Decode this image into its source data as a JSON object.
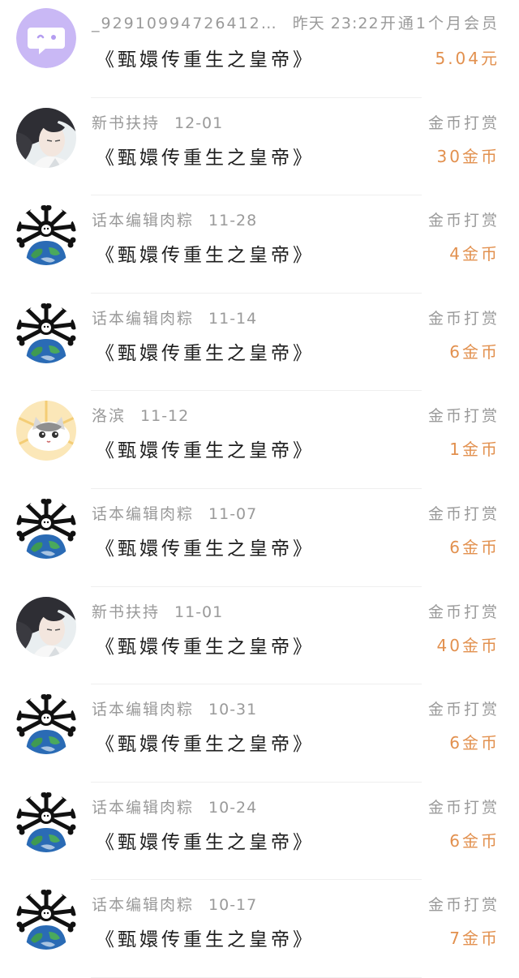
{
  "colors": {
    "amount": "#e2904e",
    "meta": "#9a9a9a",
    "title": "#1d1d1d",
    "divider": "#efefef",
    "default_avatar": "#c9b8f5"
  },
  "records": [
    {
      "user": "_92910994726412…",
      "date": "昨天 23:22",
      "title": "《甄嬛传重生之皇帝》",
      "type": "开通1个月会员",
      "amount": "5.04元",
      "avatar": "chat-bubble-avatar"
    },
    {
      "user": "新书扶持",
      "date": "12-01",
      "title": "《甄嬛传重生之皇帝》",
      "type": "金币打赏",
      "amount": "30金币",
      "avatar": "anime-portrait-avatar"
    },
    {
      "user": "话本编辑肉粽",
      "date": "11-28",
      "title": "《甄嬛传重生之皇帝》",
      "type": "金币打赏",
      "amount": "4金币",
      "avatar": "bone-globe-avatar"
    },
    {
      "user": "话本编辑肉粽",
      "date": "11-14",
      "title": "《甄嬛传重生之皇帝》",
      "type": "金币打赏",
      "amount": "6金币",
      "avatar": "bone-globe-avatar"
    },
    {
      "user": "洛滨",
      "date": "11-12",
      "title": "《甄嬛传重生之皇帝》",
      "type": "金币打赏",
      "amount": "1金币",
      "avatar": "cat-avatar"
    },
    {
      "user": "话本编辑肉粽",
      "date": "11-07",
      "title": "《甄嬛传重生之皇帝》",
      "type": "金币打赏",
      "amount": "6金币",
      "avatar": "bone-globe-avatar"
    },
    {
      "user": "新书扶持",
      "date": "11-01",
      "title": "《甄嬛传重生之皇帝》",
      "type": "金币打赏",
      "amount": "40金币",
      "avatar": "anime-portrait-avatar"
    },
    {
      "user": "话本编辑肉粽",
      "date": "10-31",
      "title": "《甄嬛传重生之皇帝》",
      "type": "金币打赏",
      "amount": "6金币",
      "avatar": "bone-globe-avatar"
    },
    {
      "user": "话本编辑肉粽",
      "date": "10-24",
      "title": "《甄嬛传重生之皇帝》",
      "type": "金币打赏",
      "amount": "6金币",
      "avatar": "bone-globe-avatar"
    },
    {
      "user": "话本编辑肉粽",
      "date": "10-17",
      "title": "《甄嬛传重生之皇帝》",
      "type": "金币打赏",
      "amount": "7金币",
      "avatar": "bone-globe-avatar"
    }
  ]
}
